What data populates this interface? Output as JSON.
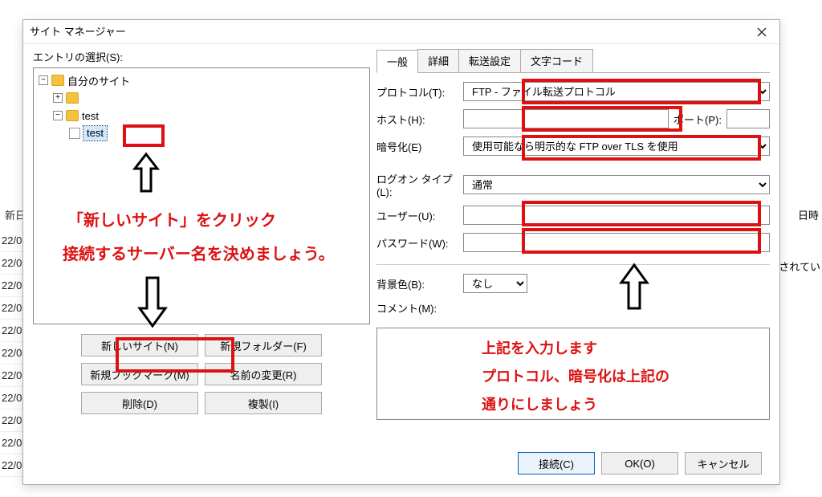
{
  "dialog": {
    "title": "サイト マネージャー",
    "entry_label": "エントリの選択(S):"
  },
  "tree": {
    "root": "自分のサイト",
    "item1": "test",
    "item2": "test"
  },
  "left_buttons": {
    "new_site": "新しいサイト(N)",
    "new_folder": "新規フォルダー(F)",
    "new_bookmark": "新規ブックマーク(M)",
    "rename": "名前の変更(R)",
    "delete": "削除(D)",
    "duplicate": "複製(I)"
  },
  "tabs": {
    "general": "一般",
    "detail": "詳細",
    "transfer": "転送設定",
    "charset": "文字コード"
  },
  "form": {
    "protocol_label": "プロトコル(T):",
    "protocol_value": "FTP - ファイル転送プロトコル",
    "host_label": "ホスト(H):",
    "port_label": "ポート(P):",
    "encryption_label": "暗号化(E)",
    "encryption_value": "使用可能なら明示的な FTP over TLS を使用",
    "logon_label": "ログオン タイプ(L):",
    "logon_value": "通常",
    "user_label": "ユーザー(U):",
    "password_label": "パスワード(W):",
    "bgcolor_label": "背景色(B):",
    "bgcolor_value": "なし",
    "comment_label": "コメント(M):",
    "host_value": "",
    "port_value": "",
    "user_value": "",
    "password_value": ""
  },
  "footer": {
    "connect": "接続(C)",
    "ok": "OK(O)",
    "cancel": "キャンセル"
  },
  "bg": {
    "header_left": "新日",
    "header_right": "日時",
    "row": "22/0",
    "right_bottom": "続されてい"
  },
  "anno": {
    "line1": "「新しいサイト」をクリック",
    "line2": "接続するサーバー名を決めましょう。",
    "r1": "上記を入力します",
    "r2": "プロトコル、暗号化は上記の",
    "r3": "通りにしましょう"
  }
}
